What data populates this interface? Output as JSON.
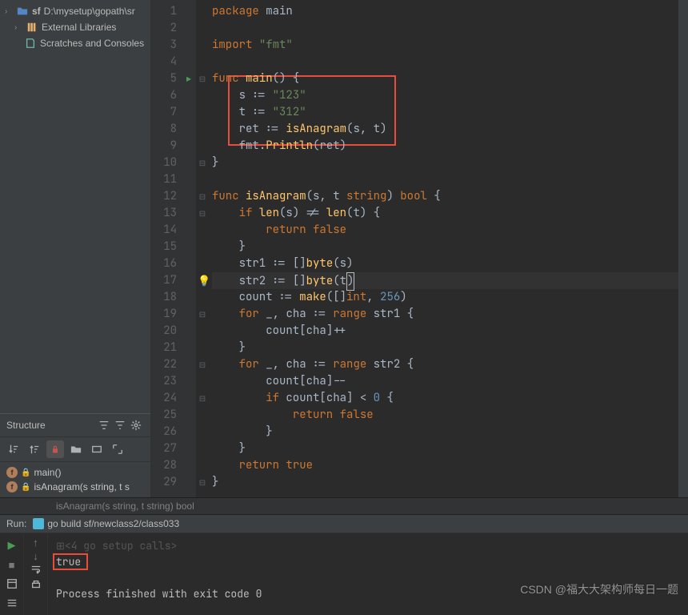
{
  "project": {
    "root_name": "sf",
    "root_path": "D:\\mysetup\\gopath\\sr",
    "external_libs": "External Libraries",
    "scratches": "Scratches and Consoles"
  },
  "structure": {
    "title": "Structure",
    "items": [
      {
        "name": "main()"
      },
      {
        "name": "isAnagram(s string, t s"
      }
    ]
  },
  "code": {
    "lines": [
      {
        "n": 1,
        "tokens": [
          {
            "t": "package ",
            "c": "kw"
          },
          {
            "t": "main",
            "c": "pkg"
          }
        ]
      },
      {
        "n": 2,
        "tokens": []
      },
      {
        "n": 3,
        "tokens": [
          {
            "t": "import ",
            "c": "kw"
          },
          {
            "t": "\"fmt\"",
            "c": "str"
          }
        ]
      },
      {
        "n": 4,
        "tokens": []
      },
      {
        "n": 5,
        "run": true,
        "fold": "⊟",
        "tokens": [
          {
            "t": "func ",
            "c": "kw"
          },
          {
            "t": "main",
            "c": "fn"
          },
          {
            "t": "() {",
            "c": "brace"
          }
        ]
      },
      {
        "n": 6,
        "tokens": [
          {
            "t": "    ",
            "c": "id"
          },
          {
            "t": "s",
            "c": "id"
          },
          {
            "t": " := ",
            "c": "op"
          },
          {
            "t": "\"123\"",
            "c": "str"
          }
        ]
      },
      {
        "n": 7,
        "tokens": [
          {
            "t": "    ",
            "c": "id"
          },
          {
            "t": "t",
            "c": "id"
          },
          {
            "t": " := ",
            "c": "op"
          },
          {
            "t": "\"312\"",
            "c": "str"
          }
        ]
      },
      {
        "n": 8,
        "tokens": [
          {
            "t": "    ",
            "c": "id"
          },
          {
            "t": "ret",
            "c": "id"
          },
          {
            "t": " := ",
            "c": "op"
          },
          {
            "t": "isAnagram",
            "c": "fn"
          },
          {
            "t": "(",
            "c": "brace"
          },
          {
            "t": "s",
            "c": "id"
          },
          {
            "t": ", ",
            "c": "op"
          },
          {
            "t": "t",
            "c": "id"
          },
          {
            "t": ")",
            "c": "brace"
          }
        ]
      },
      {
        "n": 9,
        "tokens": [
          {
            "t": "    ",
            "c": "id"
          },
          {
            "t": "fmt",
            "c": "id"
          },
          {
            "t": ".",
            "c": "op"
          },
          {
            "t": "Println",
            "c": "fn"
          },
          {
            "t": "(",
            "c": "brace"
          },
          {
            "t": "ret",
            "c": "id"
          },
          {
            "t": ")",
            "c": "brace"
          }
        ]
      },
      {
        "n": 10,
        "fold": "⊟",
        "tokens": [
          {
            "t": "}",
            "c": "brace"
          }
        ]
      },
      {
        "n": 11,
        "tokens": []
      },
      {
        "n": 12,
        "fold": "⊟",
        "tokens": [
          {
            "t": "func ",
            "c": "kw"
          },
          {
            "t": "isAnagram",
            "c": "fn"
          },
          {
            "t": "(",
            "c": "brace"
          },
          {
            "t": "s",
            "c": "id"
          },
          {
            "t": ", ",
            "c": "op"
          },
          {
            "t": "t",
            "c": "id"
          },
          {
            "t": " string",
            "c": "typ"
          },
          {
            "t": ") ",
            "c": "brace"
          },
          {
            "t": "bool",
            "c": "typ"
          },
          {
            "t": " {",
            "c": "brace"
          }
        ]
      },
      {
        "n": 13,
        "fold": "⊟",
        "tokens": [
          {
            "t": "    ",
            "c": "id"
          },
          {
            "t": "if ",
            "c": "kw"
          },
          {
            "t": "len",
            "c": "fn"
          },
          {
            "t": "(",
            "c": "brace"
          },
          {
            "t": "s",
            "c": "id"
          },
          {
            "t": ") != ",
            "c": "op"
          },
          {
            "t": "len",
            "c": "fn"
          },
          {
            "t": "(",
            "c": "brace"
          },
          {
            "t": "t",
            "c": "id"
          },
          {
            "t": ") {",
            "c": "brace"
          }
        ]
      },
      {
        "n": 14,
        "tokens": [
          {
            "t": "        ",
            "c": "id"
          },
          {
            "t": "return ",
            "c": "kw"
          },
          {
            "t": "false",
            "c": "kw"
          }
        ]
      },
      {
        "n": 15,
        "tokens": [
          {
            "t": "    }",
            "c": "brace"
          }
        ]
      },
      {
        "n": 16,
        "tokens": [
          {
            "t": "    ",
            "c": "id"
          },
          {
            "t": "str1",
            "c": "id"
          },
          {
            "t": " := []",
            "c": "op"
          },
          {
            "t": "byte",
            "c": "fn"
          },
          {
            "t": "(",
            "c": "brace"
          },
          {
            "t": "s",
            "c": "id"
          },
          {
            "t": ")",
            "c": "brace"
          }
        ]
      },
      {
        "n": 17,
        "highlight": true,
        "bulb": true,
        "tokens": [
          {
            "t": "    ",
            "c": "id"
          },
          {
            "t": "str2",
            "c": "id"
          },
          {
            "t": " := []",
            "c": "op"
          },
          {
            "t": "byte",
            "c": "fn"
          },
          {
            "t": "(",
            "c": "brace"
          },
          {
            "t": "t",
            "c": "id"
          },
          {
            "t": ")",
            "c": "cursor-box"
          }
        ]
      },
      {
        "n": 18,
        "tokens": [
          {
            "t": "    ",
            "c": "id"
          },
          {
            "t": "count",
            "c": "id"
          },
          {
            "t": " := ",
            "c": "op"
          },
          {
            "t": "make",
            "c": "fn"
          },
          {
            "t": "([]",
            "c": "brace"
          },
          {
            "t": "int",
            "c": "typ"
          },
          {
            "t": ", ",
            "c": "op"
          },
          {
            "t": "256",
            "c": "num"
          },
          {
            "t": ")",
            "c": "brace"
          }
        ]
      },
      {
        "n": 19,
        "fold": "⊟",
        "tokens": [
          {
            "t": "    ",
            "c": "id"
          },
          {
            "t": "for ",
            "c": "kw"
          },
          {
            "t": "_",
            "c": "id"
          },
          {
            "t": ", ",
            "c": "op"
          },
          {
            "t": "cha",
            "c": "id"
          },
          {
            "t": " := ",
            "c": "op"
          },
          {
            "t": "range ",
            "c": "kw"
          },
          {
            "t": "str1",
            "c": "id"
          },
          {
            "t": " {",
            "c": "brace"
          }
        ]
      },
      {
        "n": 20,
        "tokens": [
          {
            "t": "        ",
            "c": "id"
          },
          {
            "t": "count",
            "c": "id"
          },
          {
            "t": "[",
            "c": "brace"
          },
          {
            "t": "cha",
            "c": "id"
          },
          {
            "t": "]++",
            "c": "op"
          }
        ]
      },
      {
        "n": 21,
        "tokens": [
          {
            "t": "    }",
            "c": "brace"
          }
        ]
      },
      {
        "n": 22,
        "fold": "⊟",
        "tokens": [
          {
            "t": "    ",
            "c": "id"
          },
          {
            "t": "for ",
            "c": "kw"
          },
          {
            "t": "_",
            "c": "id"
          },
          {
            "t": ", ",
            "c": "op"
          },
          {
            "t": "cha",
            "c": "id"
          },
          {
            "t": " := ",
            "c": "op"
          },
          {
            "t": "range ",
            "c": "kw"
          },
          {
            "t": "str2",
            "c": "id"
          },
          {
            "t": " {",
            "c": "brace"
          }
        ]
      },
      {
        "n": 23,
        "tokens": [
          {
            "t": "        ",
            "c": "id"
          },
          {
            "t": "count",
            "c": "id"
          },
          {
            "t": "[",
            "c": "brace"
          },
          {
            "t": "cha",
            "c": "id"
          },
          {
            "t": "]--",
            "c": "op"
          }
        ]
      },
      {
        "n": 24,
        "fold": "⊟",
        "tokens": [
          {
            "t": "        ",
            "c": "id"
          },
          {
            "t": "if ",
            "c": "kw"
          },
          {
            "t": "count",
            "c": "id"
          },
          {
            "t": "[",
            "c": "brace"
          },
          {
            "t": "cha",
            "c": "id"
          },
          {
            "t": "] < ",
            "c": "op"
          },
          {
            "t": "0",
            "c": "num"
          },
          {
            "t": " {",
            "c": "brace"
          }
        ]
      },
      {
        "n": 25,
        "tokens": [
          {
            "t": "            ",
            "c": "id"
          },
          {
            "t": "return ",
            "c": "kw"
          },
          {
            "t": "false",
            "c": "kw"
          }
        ]
      },
      {
        "n": 26,
        "tokens": [
          {
            "t": "        }",
            "c": "brace"
          }
        ]
      },
      {
        "n": 27,
        "tokens": [
          {
            "t": "    }",
            "c": "brace"
          }
        ]
      },
      {
        "n": 28,
        "tokens": [
          {
            "t": "    ",
            "c": "id"
          },
          {
            "t": "return ",
            "c": "kw"
          },
          {
            "t": "true",
            "c": "kw"
          }
        ]
      },
      {
        "n": 29,
        "fold": "⊟",
        "tokens": [
          {
            "t": "}",
            "c": "brace"
          }
        ]
      }
    ],
    "breadcrumb": "isAnagram(s string, t string) bool"
  },
  "run": {
    "label": "Run:",
    "config": "go build sf/newclass2/class033",
    "setup_calls": "<4 go setup calls>",
    "output_true": "true",
    "exit_msg": "Process finished with exit code 0"
  },
  "watermark": "CSDN @福大大架构师每日一题"
}
